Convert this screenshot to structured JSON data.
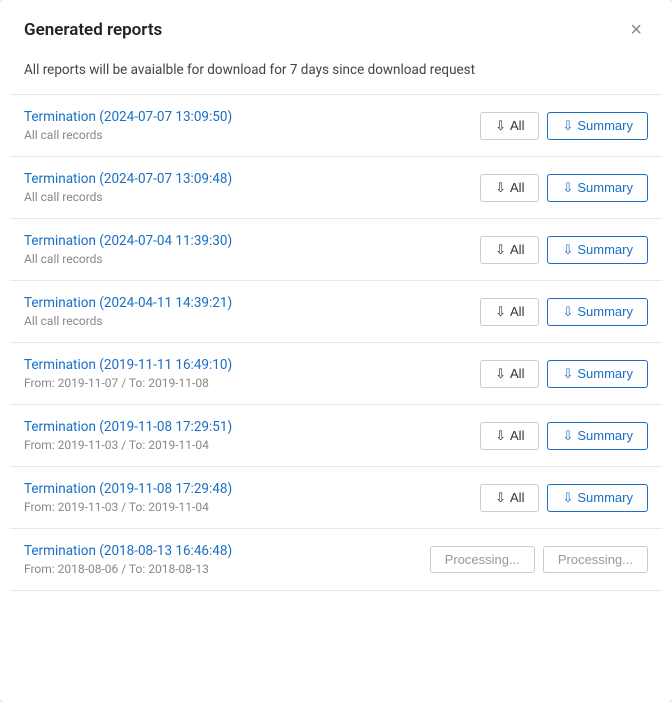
{
  "modal": {
    "title": "Generated reports",
    "close_label": "×",
    "info": "All reports will be avaialble for download for 7 days since download request"
  },
  "buttons": {
    "all_label": "All",
    "summary_label": "Summary",
    "processing_label": "Processing..."
  },
  "reports": [
    {
      "name": "Termination (2024-07-07 13:09:50)",
      "sub": "All call records",
      "state": "ready"
    },
    {
      "name": "Termination (2024-07-07 13:09:48)",
      "sub": "All call records",
      "state": "ready"
    },
    {
      "name": "Termination (2024-07-04 11:39:30)",
      "sub": "All call records",
      "state": "ready"
    },
    {
      "name": "Termination (2024-04-11 14:39:21)",
      "sub": "All call records",
      "state": "ready"
    },
    {
      "name": "Termination (2019-11-11 16:49:10)",
      "sub": "From: 2019-11-07 / To: 2019-11-08",
      "state": "ready"
    },
    {
      "name": "Termination (2019-11-08 17:29:51)",
      "sub": "From: 2019-11-03 / To: 2019-11-04",
      "state": "ready"
    },
    {
      "name": "Termination (2019-11-08 17:29:48)",
      "sub": "From: 2019-11-03 / To: 2019-11-04",
      "state": "ready"
    },
    {
      "name": "Termination (2018-08-13 16:46:48)",
      "sub": "From: 2018-08-06 / To: 2018-08-13",
      "state": "processing"
    }
  ]
}
